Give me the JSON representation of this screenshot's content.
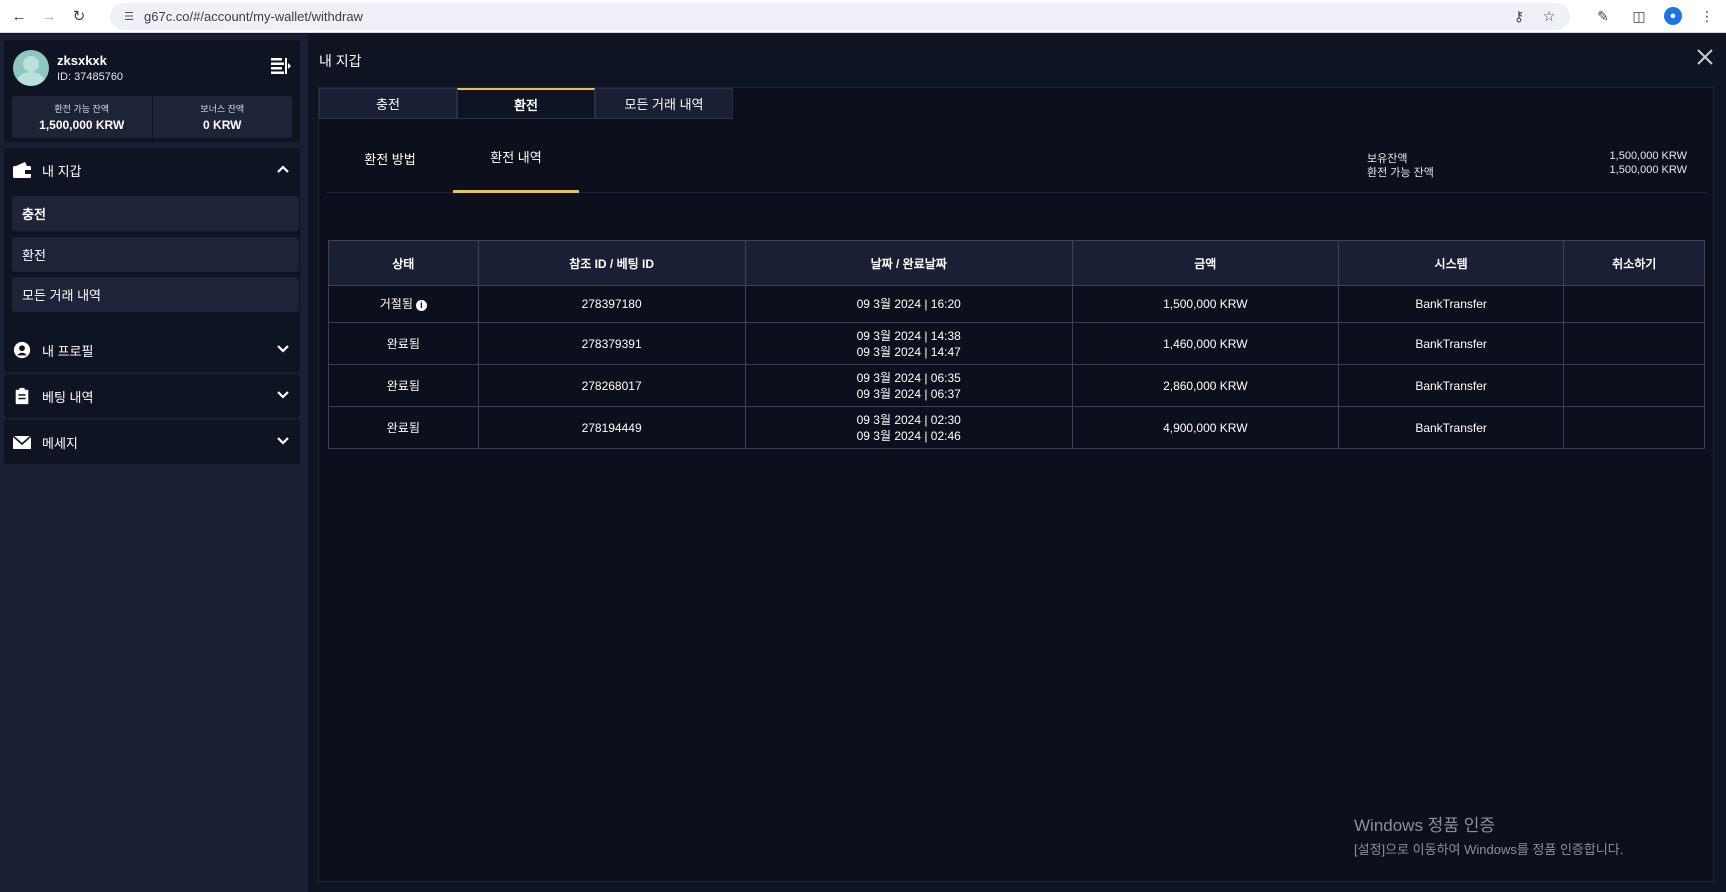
{
  "browser": {
    "url": "g67c.co/#/account/my-wallet/withdraw"
  },
  "sidebar": {
    "username": "zksxkxk",
    "user_id": "ID: 37485760",
    "balances": [
      {
        "label": "환전 가능 잔액",
        "value": "1,500,000 KRW"
      },
      {
        "label": "보너스 잔액",
        "value": "0 KRW"
      }
    ],
    "wallet": {
      "label": "내 지갑",
      "items": [
        "충전",
        "환전",
        "모든 거래 내역"
      ]
    },
    "profile_label": "내 프로필",
    "betting_label": "베팅 내역",
    "message_label": "메세지"
  },
  "main": {
    "title": "내 지갑",
    "tabs": [
      "충전",
      "환전",
      "모든 거래 내역"
    ],
    "sub_tabs": [
      "환전 방법",
      "환전 내역"
    ],
    "summary": [
      {
        "label": "보유잔액",
        "value": "1,500,000 KRW"
      },
      {
        "label": "환전 가능 잔액",
        "value": "1,500,000 KRW"
      }
    ]
  },
  "table": {
    "headers": [
      "상태",
      "참조 ID / 베팅 ID",
      "날짜 / 완료날짜",
      "금액",
      "시스템",
      "취소하기"
    ],
    "rows": [
      {
        "status": "거절됨",
        "id": "278397180",
        "date1": "09 3월 2024 | 16:20",
        "date2": "",
        "amount": "1,500,000 KRW",
        "system": "BankTransfer",
        "cancel": ""
      },
      {
        "status": "완료됨",
        "id": "278379391",
        "date1": "09 3월 2024 | 14:38",
        "date2": "09 3월 2024 | 14:47",
        "amount": "1,460,000 KRW",
        "system": "BankTransfer",
        "cancel": ""
      },
      {
        "status": "완료됨",
        "id": "278268017",
        "date1": "09 3월 2024 | 06:35",
        "date2": "09 3월 2024 | 06:37",
        "amount": "2,860,000 KRW",
        "system": "BankTransfer",
        "cancel": ""
      },
      {
        "status": "완료됨",
        "id": "278194449",
        "date1": "09 3월 2024 | 02:30",
        "date2": "09 3월 2024 | 02:46",
        "amount": "4,900,000 KRW",
        "system": "BankTransfer",
        "cancel": ""
      }
    ]
  },
  "watermark": {
    "title": "Windows 정품 인증",
    "subtitle": "[설정]으로 이동하여 Windows를 정품 인증합니다."
  }
}
